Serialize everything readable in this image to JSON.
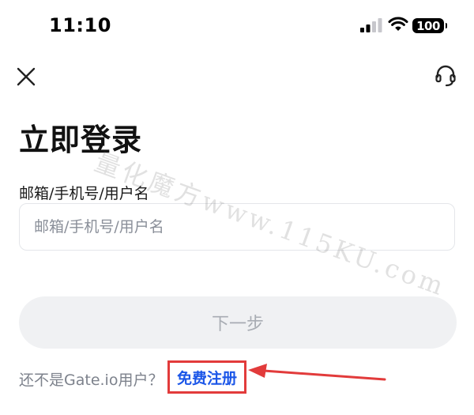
{
  "status_bar": {
    "time": "11:10",
    "battery": "100"
  },
  "header": {
    "close_icon": "close-icon",
    "support_icon": "headset-icon"
  },
  "page": {
    "title": "立即登录",
    "field_label": "邮箱/手机号/用户名",
    "input_placeholder": "邮箱/手机号/用户名",
    "input_value": "",
    "next_button": "下一步",
    "register_prompt": "还不是Gate.io用户？",
    "register_link": "免费注册"
  },
  "watermark": "量化魔方www.115KU.com",
  "colors": {
    "register_link": "#1b56e8",
    "highlight": "#e23b3b",
    "button_bg": "#f0f1f3",
    "button_text": "#a8acb3"
  }
}
